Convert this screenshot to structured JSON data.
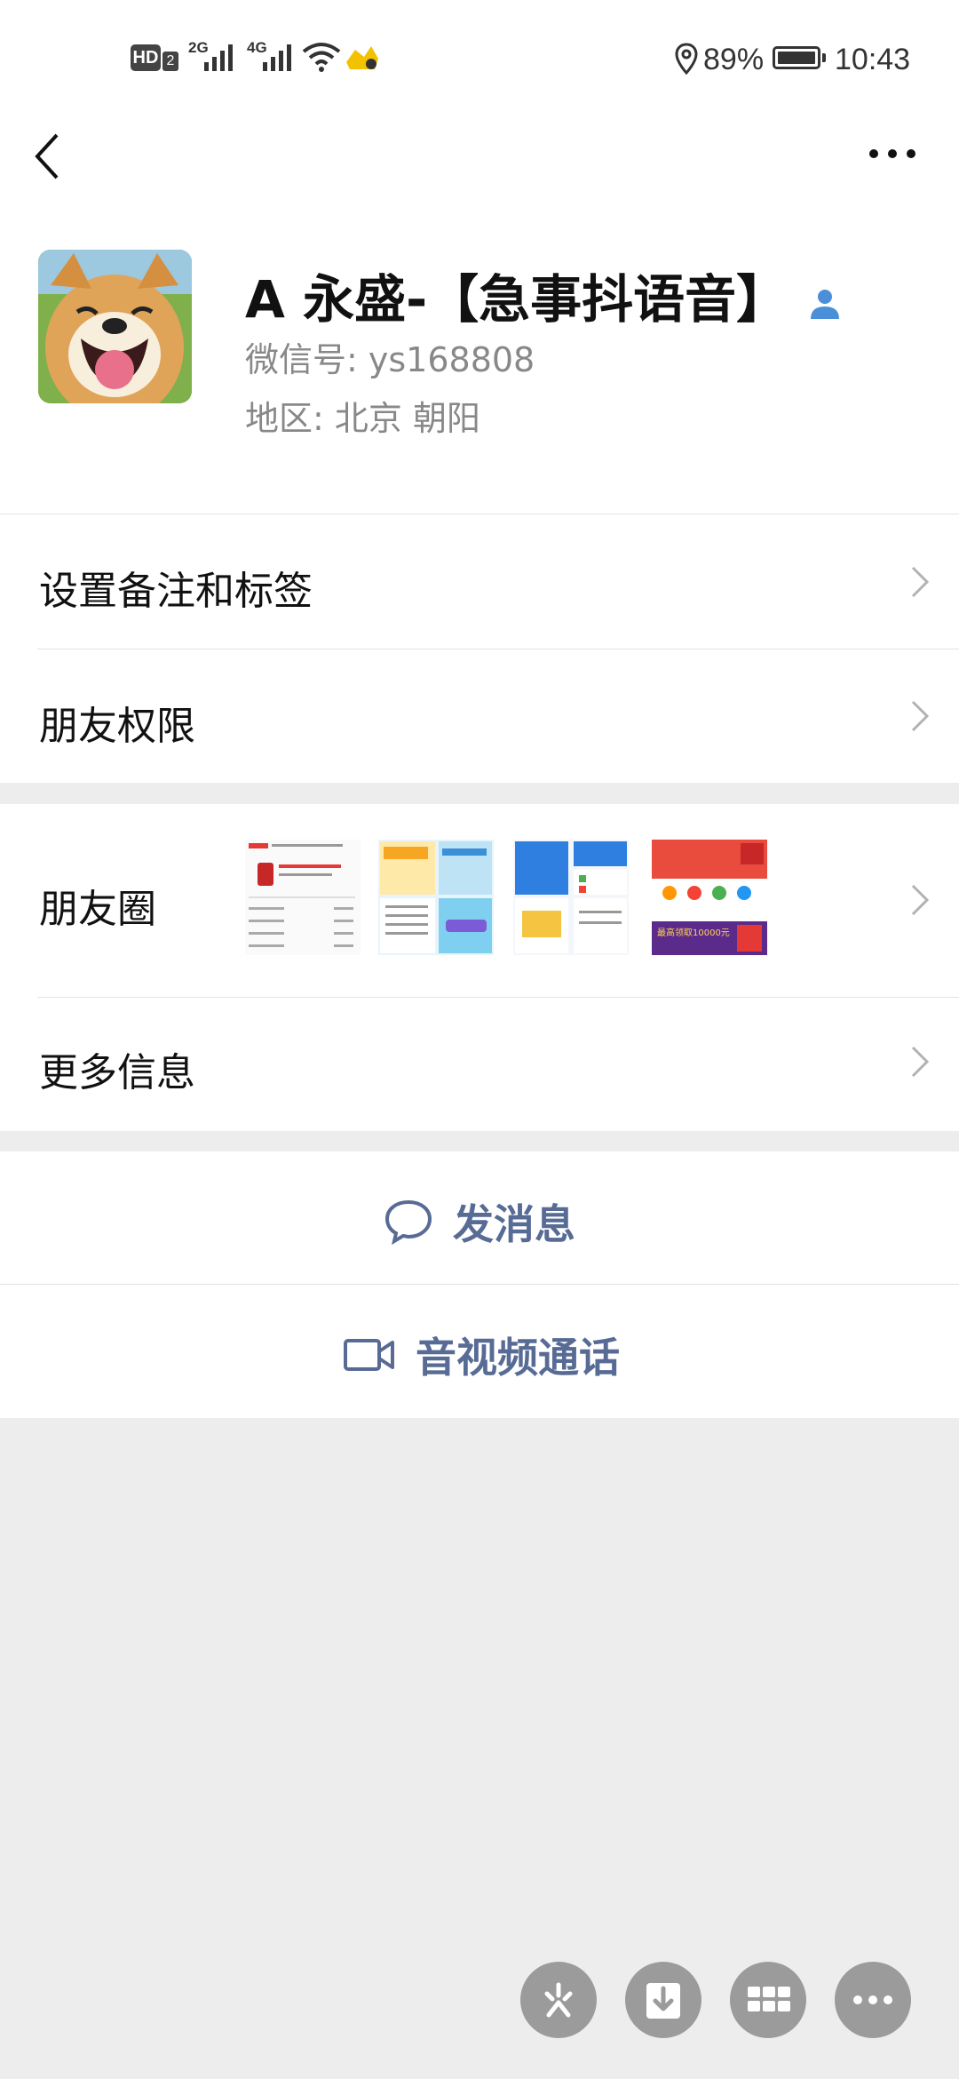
{
  "status_bar": {
    "left_indicators": [
      "HD",
      "2",
      "2G",
      "4G"
    ],
    "battery": "89%",
    "time": "10:43"
  },
  "nav": {
    "back_icon": "chevron-left-icon",
    "more_icon": "more-dots-icon"
  },
  "profile": {
    "name": "A 永盛-【急事抖语音】",
    "wechat_id": "微信号:  ys168808",
    "region": "地区:  北京  朝阳"
  },
  "rows": {
    "remark": "设置备注和标签",
    "permissions": "朋友权限",
    "moments": "朋友圈",
    "more_info": "更多信息"
  },
  "moments_thumbs": {
    "t4_text": "最高领取10000元"
  },
  "actions": {
    "message": "发消息",
    "call": "音视频通话"
  },
  "colors": {
    "link_blue": "#576b95",
    "background_gray": "#ededed"
  }
}
